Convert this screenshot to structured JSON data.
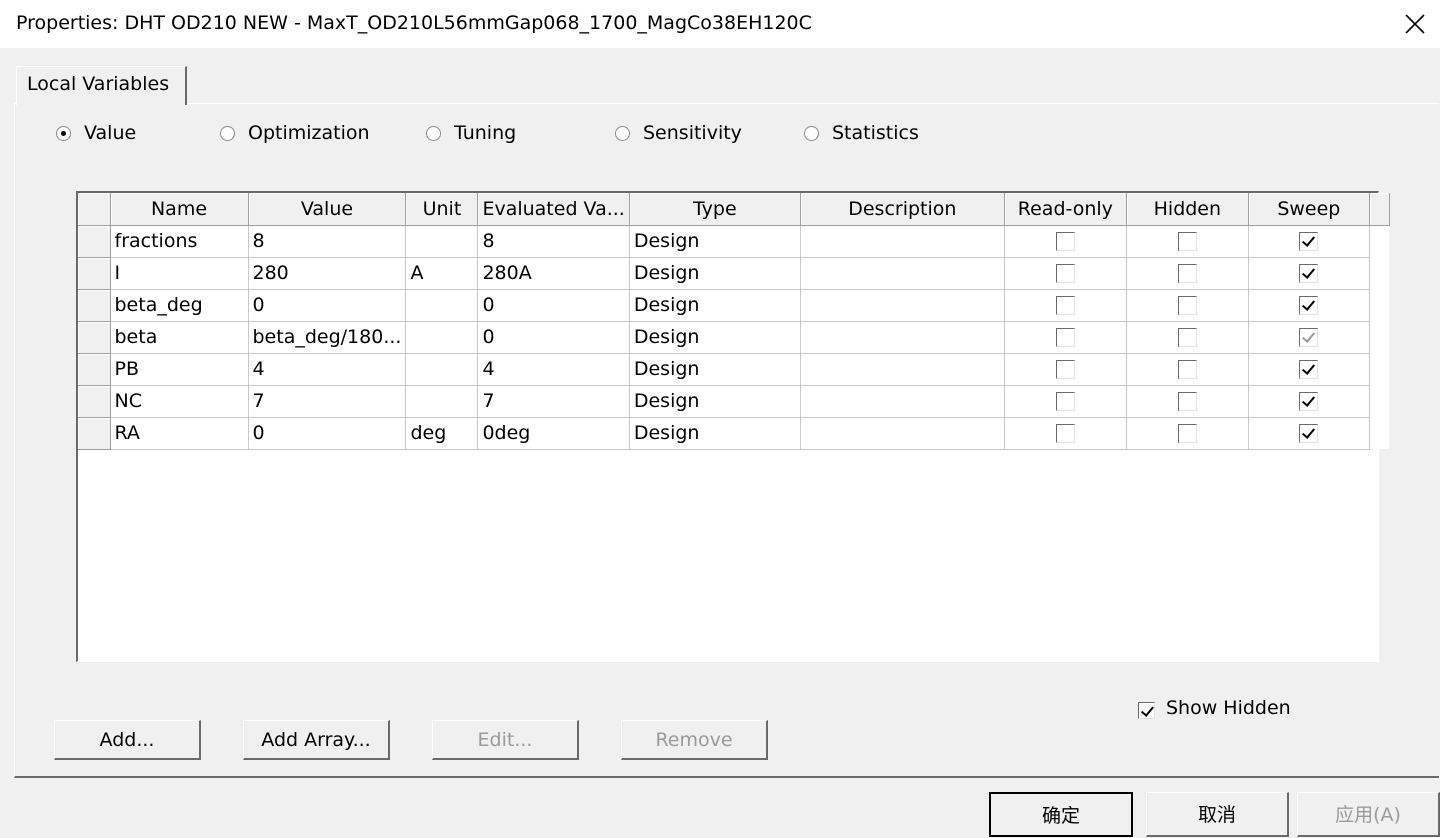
{
  "window": {
    "title": "Properties: DHT OD210 NEW - MaxT_OD210L56mmGap068_1700_MagCo38EH120C",
    "close_icon": "close-icon"
  },
  "tabs": [
    {
      "label": "Local Variables",
      "active": true
    }
  ],
  "modes": [
    {
      "label": "Value",
      "selected": true
    },
    {
      "label": "Optimization",
      "selected": false
    },
    {
      "label": "Tuning",
      "selected": false
    },
    {
      "label": "Sensitivity",
      "selected": false
    },
    {
      "label": "Statistics",
      "selected": false
    }
  ],
  "table": {
    "columns": [
      "Name",
      "Value",
      "Unit",
      "Evaluated Va...",
      "Type",
      "Description",
      "Read-only",
      "Hidden",
      "Sweep"
    ],
    "rows": [
      {
        "name": "fractions",
        "value": "8",
        "unit": "",
        "evaluated": "8",
        "type": "Design",
        "description": "",
        "read_only": false,
        "hidden": false,
        "sweep": true,
        "sweep_disabled": false
      },
      {
        "name": "I",
        "value": "280",
        "unit": "A",
        "evaluated": "280A",
        "type": "Design",
        "description": "",
        "read_only": false,
        "hidden": false,
        "sweep": true,
        "sweep_disabled": false
      },
      {
        "name": "beta_deg",
        "value": "0",
        "unit": "",
        "evaluated": "0",
        "type": "Design",
        "description": "",
        "read_only": false,
        "hidden": false,
        "sweep": true,
        "sweep_disabled": false
      },
      {
        "name": "beta",
        "value": "beta_deg/180...",
        "unit": "",
        "evaluated": "0",
        "type": "Design",
        "description": "",
        "read_only": false,
        "hidden": false,
        "sweep": true,
        "sweep_disabled": true
      },
      {
        "name": "PB",
        "value": "4",
        "unit": "",
        "evaluated": "4",
        "type": "Design",
        "description": "",
        "read_only": false,
        "hidden": false,
        "sweep": true,
        "sweep_disabled": false
      },
      {
        "name": "NC",
        "value": "7",
        "unit": "",
        "evaluated": "7",
        "type": "Design",
        "description": "",
        "read_only": false,
        "hidden": false,
        "sweep": true,
        "sweep_disabled": false
      },
      {
        "name": "RA",
        "value": "0",
        "unit": "deg",
        "evaluated": "0deg",
        "type": "Design",
        "description": "",
        "read_only": false,
        "hidden": false,
        "sweep": true,
        "sweep_disabled": false
      }
    ]
  },
  "show_hidden": {
    "label": "Show Hidden",
    "checked": true
  },
  "actions": {
    "add": "Add...",
    "add_array": "Add Array...",
    "edit": "Edit...",
    "remove": "Remove"
  },
  "footer": {
    "ok": "确定",
    "cancel": "取消",
    "apply": "应用(A)"
  }
}
